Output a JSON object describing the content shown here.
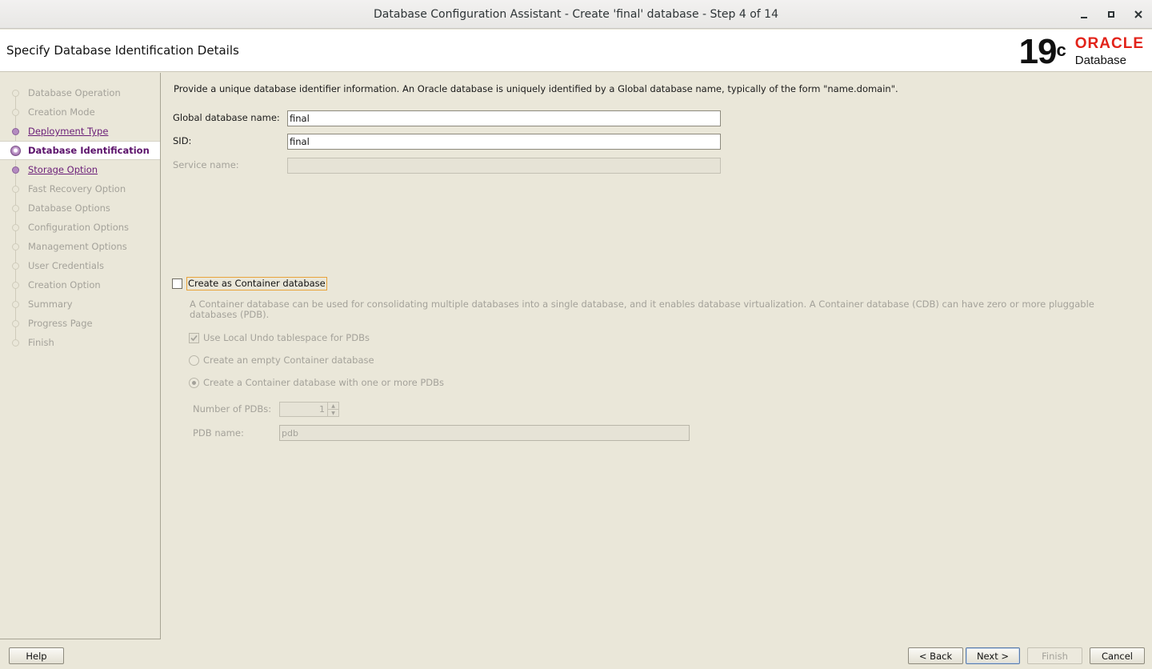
{
  "window": {
    "title": "Database Configuration Assistant - Create 'final' database - Step 4 of 14"
  },
  "header": {
    "page_title": "Specify Database Identification Details",
    "logo": {
      "version": "19",
      "version_sup": "c",
      "brand": "ORACLE",
      "product": "Database"
    }
  },
  "nav": {
    "items": [
      {
        "label": "Database Operation",
        "state": "disabled"
      },
      {
        "label": "Creation Mode",
        "state": "disabled"
      },
      {
        "label": "Deployment Type",
        "state": "visited"
      },
      {
        "label": "Database Identification",
        "state": "current"
      },
      {
        "label": "Storage Option",
        "state": "visited"
      },
      {
        "label": "Fast Recovery Option",
        "state": "disabled"
      },
      {
        "label": "Database Options",
        "state": "disabled"
      },
      {
        "label": "Configuration Options",
        "state": "disabled"
      },
      {
        "label": "Management Options",
        "state": "disabled"
      },
      {
        "label": "User Credentials",
        "state": "disabled"
      },
      {
        "label": "Creation Option",
        "state": "disabled"
      },
      {
        "label": "Summary",
        "state": "disabled"
      },
      {
        "label": "Progress Page",
        "state": "disabled"
      },
      {
        "label": "Finish",
        "state": "disabled"
      }
    ]
  },
  "main": {
    "intro": "Provide a unique database identifier information. An Oracle database is uniquely identified by a Global database name, typically of the form \"name.domain\".",
    "global_db_name": {
      "label": "Global database name:",
      "value": "final"
    },
    "sid": {
      "label": "SID:",
      "value": "final"
    },
    "service_name": {
      "label": "Service name:",
      "value": ""
    },
    "container": {
      "label": "Create as Container database",
      "checked": false,
      "description": "A Container database can be used for consolidating multiple databases into a single database, and it enables database virtualization. A Container database (CDB) can have zero or more pluggable databases (PDB).",
      "local_undo_label": "Use Local Undo tablespace for PDBs",
      "empty_cdb_label": "Create an empty Container database",
      "with_pdbs_label": "Create a Container database with one or more PDBs",
      "num_pdbs_label": "Number of PDBs:",
      "num_pdbs_value": "1",
      "pdb_name_label": "PDB name:",
      "pdb_name_value": "pdb"
    }
  },
  "buttons": {
    "help": "Help",
    "back": "< Back",
    "next": "Next >",
    "finish": "Finish",
    "cancel": "Cancel"
  },
  "colors": {
    "accent_purple": "#6b1f78",
    "oracle_red": "#e2231a",
    "panel_bg": "#eae7d9"
  }
}
